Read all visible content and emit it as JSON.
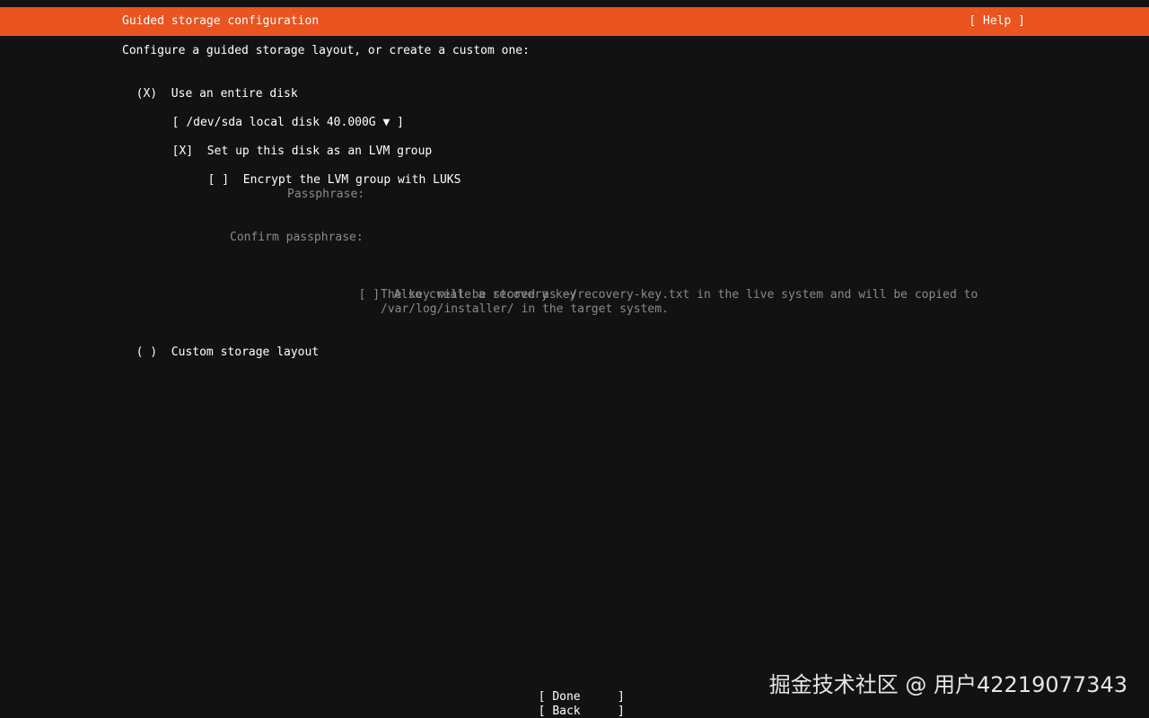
{
  "header": {
    "title": "Guided storage configuration",
    "help_label": "[ Help ]"
  },
  "intro": "Configure a guided storage layout, or create a custom one:",
  "options": {
    "entire_disk": {
      "marker": "(X)",
      "label": "Use an entire disk"
    },
    "disk_select": {
      "open": "[",
      "value": "/dev/sda local disk 40.000G",
      "arrow": "▼",
      "close": "]"
    },
    "lvm": {
      "marker": "[X]",
      "label": "Set up this disk as an LVM group"
    },
    "luks": {
      "marker": "[ ]",
      "label": "Encrypt the LVM group with LUKS"
    },
    "passphrase_label": "Passphrase:",
    "confirm_passphrase_label": "Confirm passphrase:",
    "recovery": {
      "marker": "[ ]",
      "label": "Also create a recovery key",
      "desc_line1": "The key will be stored as ~/recovery-key.txt in the live system and will be copied to",
      "desc_line2": "/var/log/installer/ in the target system."
    },
    "custom": {
      "marker": "( )",
      "label": "Custom storage layout"
    }
  },
  "buttons": {
    "done": {
      "open": "[",
      "label": "Done",
      "close": "]"
    },
    "back": {
      "open": "[",
      "label": "Back",
      "close": "]"
    }
  },
  "watermark": "掘金技术社区 @ 用户42219077343",
  "colors": {
    "header_bg": "#e95420",
    "background": "#121212",
    "text": "#ffffff",
    "dim_text": "#8a8a8a"
  }
}
